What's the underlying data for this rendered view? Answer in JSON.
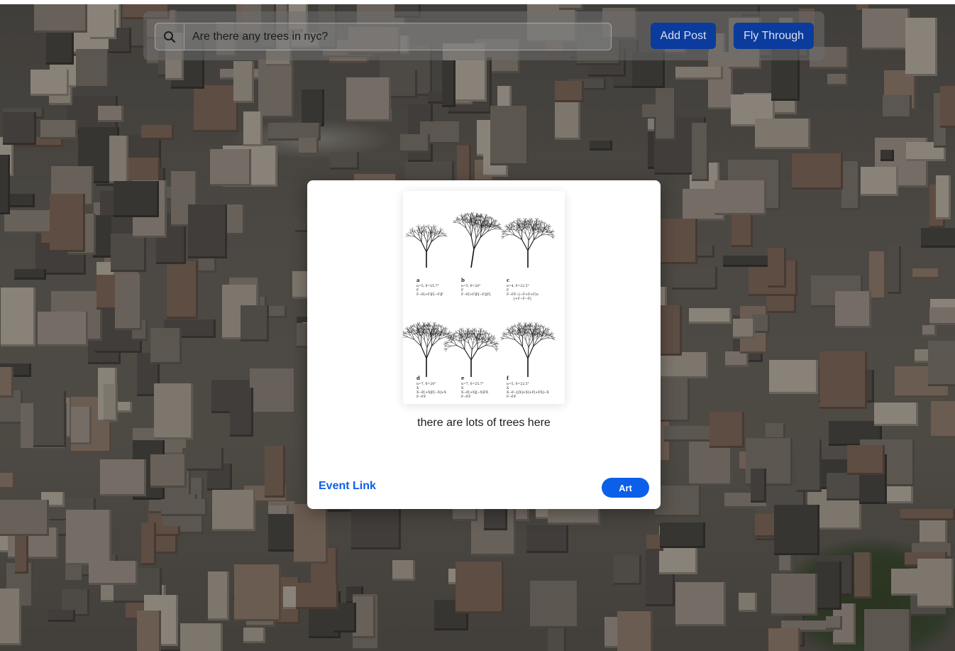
{
  "search": {
    "value": "Are there any trees in nyc?",
    "icon": "search-icon"
  },
  "toolbar": {
    "add_post_label": "Add Post",
    "fly_through_label": "Fly Through"
  },
  "post": {
    "caption": "there are lots of trees here",
    "event_link_label": "Event Link",
    "category_badge": "Art",
    "image": {
      "panels": [
        {
          "letter": "a",
          "lines": [
            "n=5, δ=25.7°",
            "F",
            "F→F[+F]F[−F]F"
          ]
        },
        {
          "letter": "b",
          "lines": [
            "n=5, δ=20°",
            "F",
            "F→F[+F]F[−F][F]"
          ]
        },
        {
          "letter": "c",
          "lines": [
            "n=4, δ=22.5°",
            "F",
            "F→FF−[−F+F+F]+",
            "[+F−F−F]"
          ]
        },
        {
          "letter": "d",
          "lines": [
            "n=7, δ=20°",
            "X",
            "X→F[+X]F[−X]+X",
            "F→FF"
          ]
        },
        {
          "letter": "e",
          "lines": [
            "n=7, δ=25.7°",
            "X",
            "X→F[+X][−X]FX",
            "F→FF"
          ]
        },
        {
          "letter": "f",
          "lines": [
            "n=5, δ=22.5°",
            "X",
            "X→F−[[X]+X]+F[+FX]−X",
            "F→FF"
          ]
        }
      ]
    }
  },
  "colors": {
    "primary_button": "#0b3b9c",
    "link": "#0b5fe8",
    "badge": "#0b5fe8"
  }
}
